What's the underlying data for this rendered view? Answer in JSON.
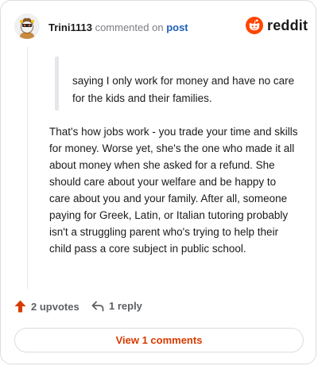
{
  "header": {
    "username": "Trini1113",
    "action_text": "commented on",
    "post_link": "post",
    "brand": "reddit"
  },
  "comment": {
    "quote": "saying I only work for money and have no care for the kids and their families.",
    "body": "That's how jobs work - you trade your time and skills for money. Worse yet, she's the one who made it all about money when she asked for a refund. She should care about your welfare and be happy to care about you and your family. After all, someone paying for Greek, Latin, or Italian tutoring probably isn't a struggling parent who's trying to help their child pass a core subject in public school."
  },
  "actions": {
    "upvotes": "2 upvotes",
    "reply": "1 reply",
    "view_comments": "View 1 comments"
  },
  "icons": {
    "avatar": "snoo-avatar",
    "brand": "reddit-snoo-icon",
    "upvote": "upvote-arrow-icon",
    "reply": "reply-arrow-icon"
  },
  "colors": {
    "brand_orange": "#ff4500",
    "upvote_orange": "#d93a00",
    "link_blue": "#1f5fb6"
  }
}
